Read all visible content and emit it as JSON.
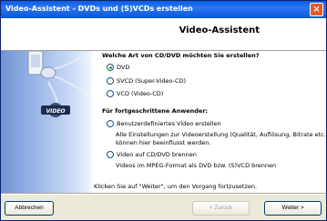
{
  "window": {
    "title": "Video-Assistent - DVDs und (S)VCDs erstellen"
  },
  "header": {
    "title": "Video-Assistent"
  },
  "graphic": {
    "badge_text": "VIDEO"
  },
  "question": {
    "title": "Welche Art von CD/DVD möchten Sie erstellen?"
  },
  "options": [
    {
      "label": "DVD",
      "checked": true
    },
    {
      "label": "SVCD (Super-Video-CD)",
      "checked": false
    },
    {
      "label": "VCD (Video-CD)",
      "checked": false
    }
  ],
  "advanced": {
    "title": "Für fortgeschrittene Anwender:",
    "custom": {
      "label": "Benutzerdefiniertes Video erstellen",
      "desc1": "Alle Einstellungen zur Videoerstellung (Qualität, Auflösung, Bitrate etc.)",
      "desc2": "können hier beeinflusst werden."
    },
    "burn": {
      "label": "Video auf CD/DVD brennen",
      "desc1": "Videos im MPEG-Format als DVD bzw. (S)VCD brennen"
    }
  },
  "footer_hint": "Klicken Sie auf \"Weiter\", um den Vorgang fortzusetzen.",
  "buttons": {
    "cancel": "Abbrechen",
    "back": "< Zurück",
    "next": "Weiter >"
  }
}
